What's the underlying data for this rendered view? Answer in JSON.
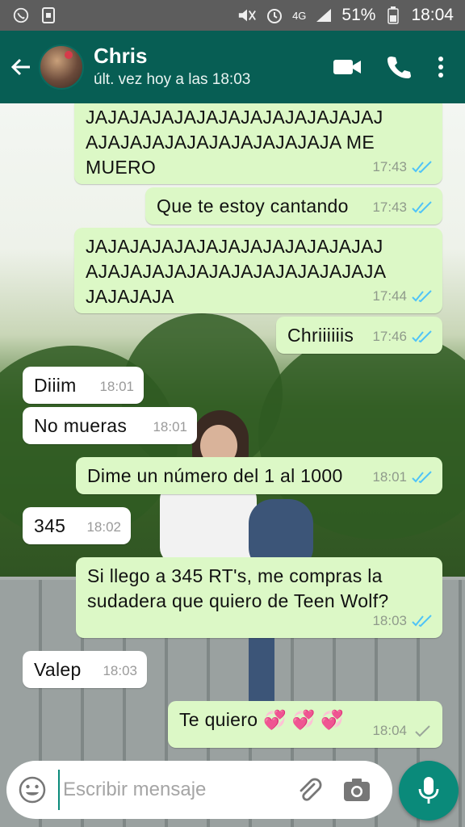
{
  "status_bar": {
    "battery": "51%",
    "time": "18:04",
    "network": "4G"
  },
  "header": {
    "contact_name": "Chris",
    "last_seen": "últ. vez hoy a las 18:03",
    "icons": [
      "back-arrow-icon",
      "video-call-icon",
      "phone-icon",
      "more-vert-icon"
    ]
  },
  "messages": [
    {
      "dir": "out",
      "text": "JAJAJAJAJAJAJAJAJAJAJAJAJAJ\nAJAJAJAJAJAJAJAJAJAJAJA ME\nMUERO",
      "time": "17:43",
      "status": "read"
    },
    {
      "dir": "out",
      "text": "Que te estoy cantando",
      "time": "17:43",
      "status": "read"
    },
    {
      "dir": "out",
      "text": "JAJAJAJAJAJAJAJAJAJAJAJAJAJ\nAJAJAJAJAJAJAJAJAJAJAJAJAJA\nJAJAJAJA",
      "time": "17:44",
      "status": "read"
    },
    {
      "dir": "out",
      "text": "Chriiiiiis",
      "time": "17:46",
      "status": "read"
    },
    {
      "dir": "in",
      "text": "Diiim",
      "time": "18:01"
    },
    {
      "dir": "in",
      "text": "No mueras",
      "time": "18:01"
    },
    {
      "dir": "out",
      "text": "Dime un número del 1 al 1000",
      "time": "18:01",
      "status": "read"
    },
    {
      "dir": "in",
      "text": "345",
      "time": "18:02"
    },
    {
      "dir": "out",
      "text": "Si llego a 345 RT's, me compras la\nsudadera que quiero de Teen Wolf?",
      "time": "18:03",
      "status": "read"
    },
    {
      "dir": "in",
      "text": "Valep",
      "time": "18:03"
    },
    {
      "dir": "out",
      "text": "Te quiero 💞 💞 💞",
      "time": "18:04",
      "status": "sent"
    }
  ],
  "colors": {
    "header": "#075e54",
    "outgoing_bubble": "#dcf8c6",
    "incoming_bubble": "#ffffff",
    "read_tick": "#4fc3f7",
    "sent_tick": "#9aa59a",
    "accent": "#0a8a7a"
  },
  "composer": {
    "placeholder": "Escribir mensaje",
    "value": "",
    "icons": [
      "emoji-icon",
      "attach-icon",
      "camera-icon",
      "mic-icon"
    ]
  }
}
